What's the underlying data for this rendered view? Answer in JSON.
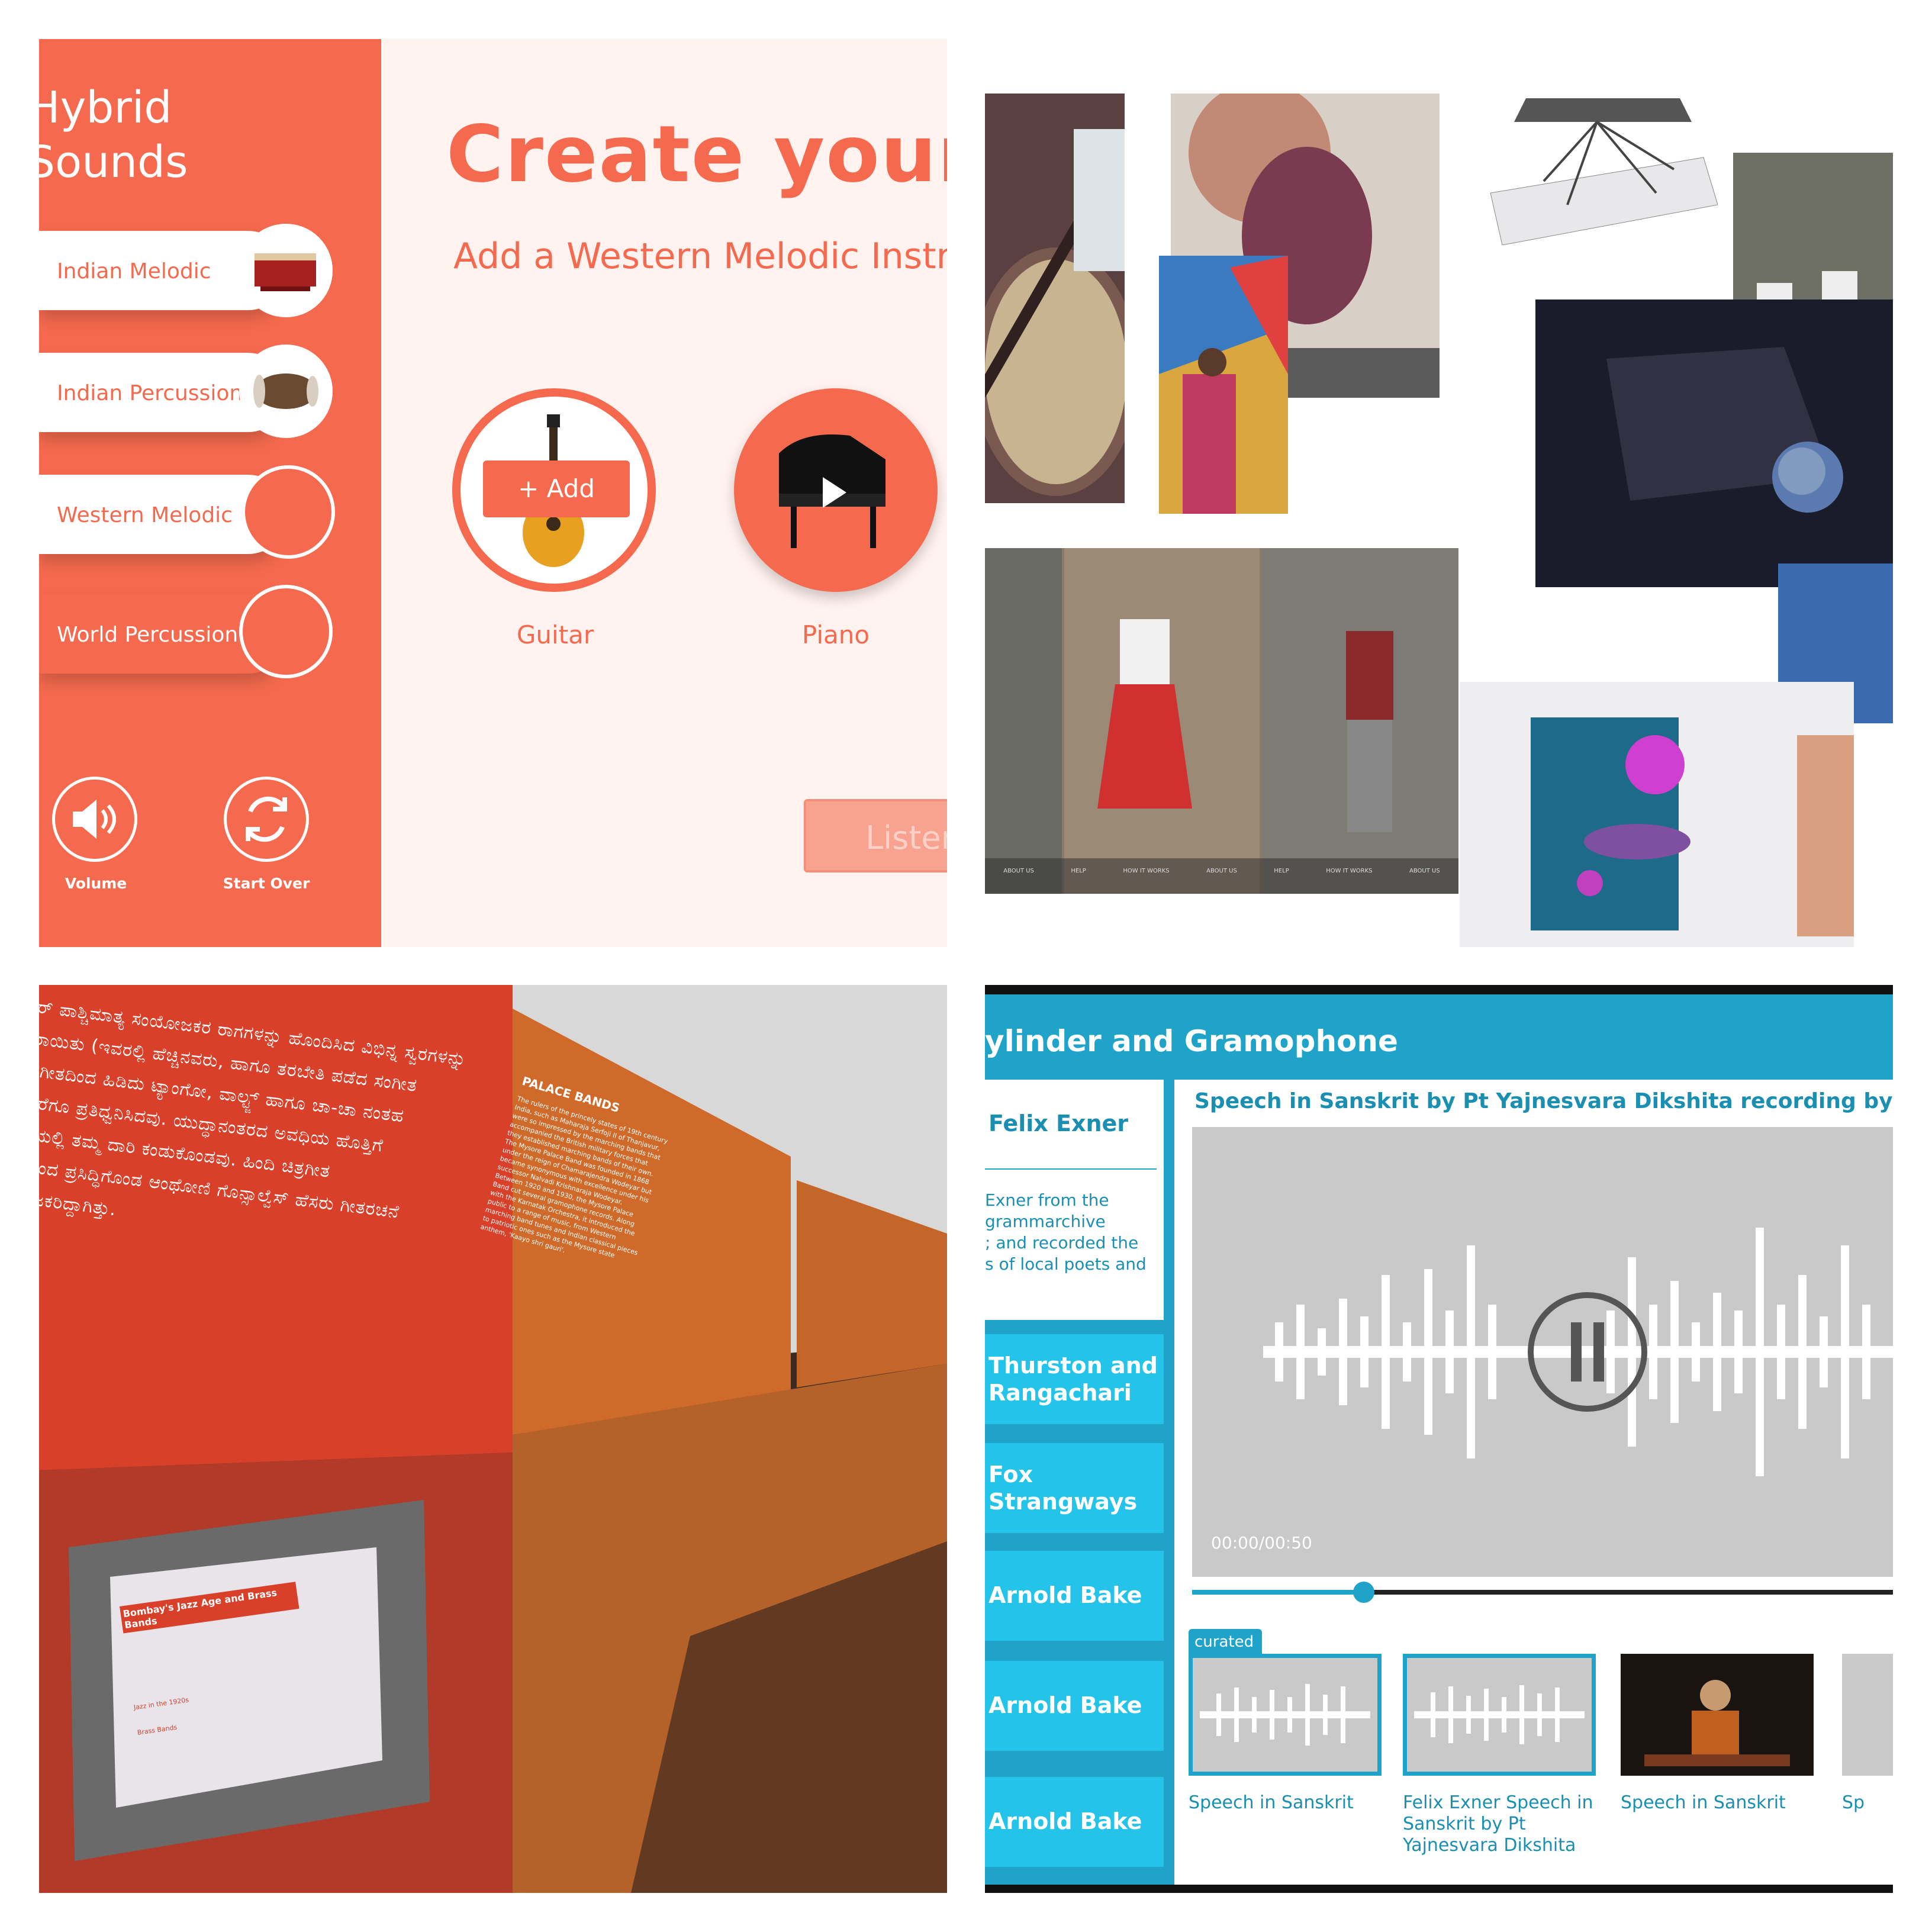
{
  "hybrid_sounds": {
    "app_title": "Hybrid\nSounds",
    "categories": [
      {
        "label": "Indian Melodic",
        "icon": "harmonium-icon"
      },
      {
        "label": "Indian Percussion",
        "icon": "dholak-icon"
      },
      {
        "label": "Western Melodic",
        "icon": ""
      },
      {
        "label": "World Percussion",
        "icon": ""
      }
    ],
    "volume_label": "Volume",
    "start_over_label": "Start Over",
    "title": "Create your m",
    "subtitle": "Add a Western Melodic Instru",
    "instruments": [
      {
        "label": "Guitar",
        "button": "+ Add"
      },
      {
        "label": "Piano"
      }
    ],
    "listen_label": "Listen",
    "accent": "#f56a4e",
    "background": "#fff2ef"
  },
  "collage": {
    "phone_nav": [
      "ABOUT US",
      "HELP",
      "HOW IT WORKS",
      "ABOUT US",
      "HELP",
      "HOW IT WORKS",
      "ABOUT US"
    ]
  },
  "museum": {
    "kannada_lines": [
      "ರ್ ಪಾಶ್ಚಿಮಾತ್ಯ ಸಂಯೋಜಕರ ರಾಗಗಳನ್ನು ಹೊಂದಿಸಿದ ವಿಭಿನ್ನ ಸ್ವರಗಳನ್ನು",
      "ರಾಯಿತು (ಇವರಲ್ಲಿ ಹೆಚ್ಚಿನವರು, ಹಾಗೂ ತರಬೇತಿ ಪಡೆದ ಸಂಗೀತ",
      "ರಿಗೀತದಿಂದ ಹಿಡಿದು ಟ್ಯಾಂಗೋ, ವಾಲ್ಟ್ಜ್ ಹಾಗೂ ಚಾ-ಚಾ ನಂತಹ",
      "ವರೆಗೂ ಪ್ರತಿಧ್ವನಿಸಿದವು. ಯುದ್ಧಾನಂತರದ ಅವಧಿಯ ಹೊತ್ತಿಗೆ",
      "ತೆಯಲ್ಲಿ ತಮ್ಮ ದಾರಿ ಕಂಡುಕೊಂಡವು. ಹಿಂದಿ ಚಿತ್ರಗೀತ",
      "ಾಂದ ಪ್ರಸಿದ್ಧಿಗೊಂಡ ಆಂಥೋಣಿ ಗೊನ್ಸಾಲ್ವೆಸ್ ಹೆಸರು ಗೀತರಚನೆ",
      "ರಂಜಕರಿದ್ದಾಗಿತ್ತು."
    ],
    "panel_title": "PALACE BANDS",
    "panel_paragraph": "The rulers of the princely states of 19th century India, such as Maharaja Serfoji II of Thanjavur, were so impressed by the marching bands that accompanied the British military forces that they established marching bands of their own. The Mysore Palace Band was founded in 1868 under the reign of Chamarajendra Wodeyar but became synonymous with excellence under his successor Nalvadi Krishnaraja Wodeyar. Between 1920 and 1930, the Mysore Palace Band cut several gramophone records. Along with the Karnatak Orchestra, it introduced the public to a range of music, from Western marching band tunes and Indian classical pieces to patriotic ones such as the Mysore state anthem, 'Kaayo shri gauri'.",
    "kiosk_title": "Bombay's Jazz Age and Brass Bands",
    "kiosk_sidebar": [
      "Jazz in the 1920s",
      "Brass Bands"
    ]
  },
  "gramophone": {
    "header_title": "ylinder and Gramophone",
    "active_item": {
      "title": "Felix Exner",
      "desc_lines": [
        "Exner from the",
        "grammarchive",
        "; and recorded the",
        "s of local poets and"
      ]
    },
    "side_items": [
      "Thurston and Rangachari",
      "Fox Strangways",
      "Arnold Bake",
      "Arnold Bake",
      "Arnold Bake"
    ],
    "recording_title": "Speech in Sanskrit by Pt Yajnesvara Dikshita recording by Felix Exner gr",
    "time": "00:00/00:50",
    "progress": 0.245,
    "curated_tag": "curated",
    "thumbs": [
      {
        "caption": "Speech in Sanskrit"
      },
      {
        "caption": "Felix Exner Speech in Sanskrit by Pt Yajnesvara Dikshita"
      },
      {
        "caption": "Speech in Sanskrit"
      },
      {
        "caption": "Sp"
      }
    ],
    "accent": "#1fa3c9",
    "accent_light": "#24c3ea"
  }
}
